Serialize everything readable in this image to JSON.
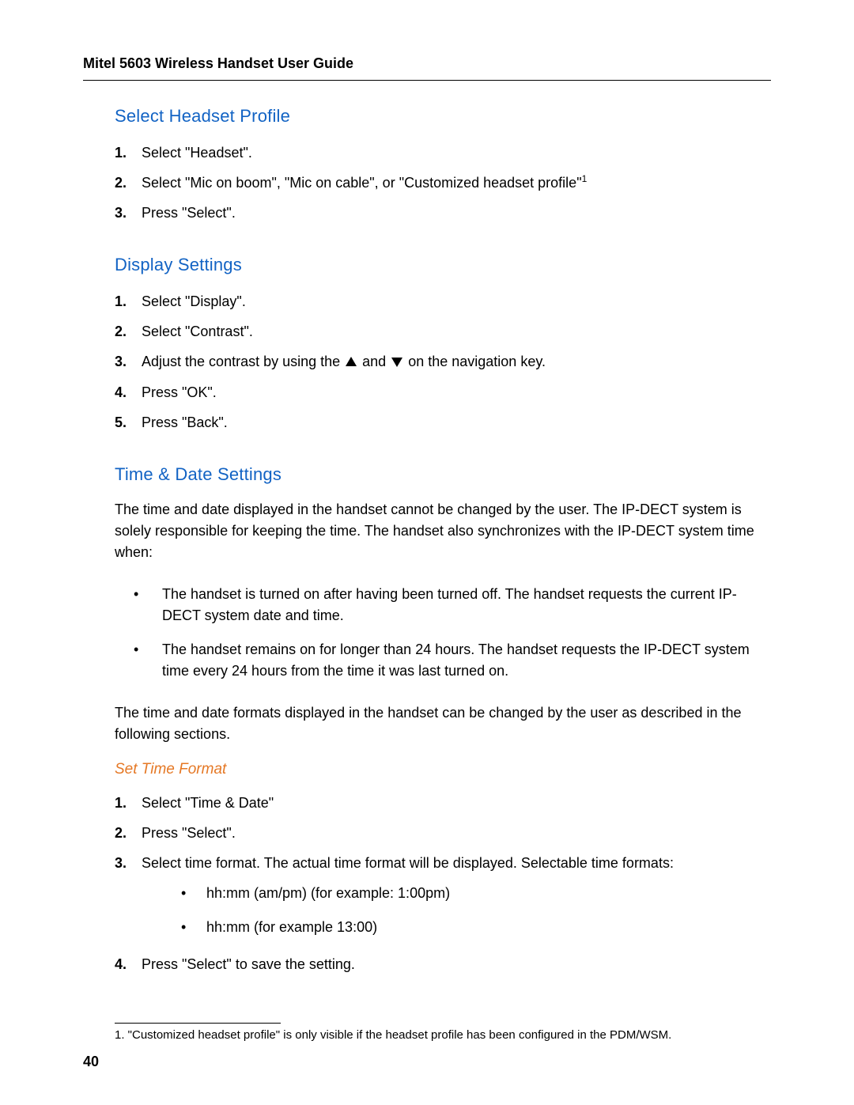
{
  "header": "Mitel 5603 Wireless Handset User Guide",
  "pageNumber": "40",
  "sectionA": {
    "title": "Select Headset Profile",
    "steps": [
      "Select \"Headset\".",
      "Select \"Mic on boom\",  \"Mic on cable\", or  \"Customized headset profile\"",
      "Press \"Select\"."
    ],
    "supRef": "1"
  },
  "sectionB": {
    "title": "Display Settings",
    "steps": {
      "s1": "Select \"Display\".",
      "s2": "Select \"Contrast\".",
      "s3a": "Adjust the contrast by using the ",
      "s3b": " and ",
      "s3c": " on the navigation key.",
      "s4": "Press \"OK\".",
      "s5": "Press \"Back\"."
    }
  },
  "sectionC": {
    "title": "Time & Date Settings",
    "para1": "The time and date displayed in the handset cannot be changed by the user. The IP-DECT system is solely responsible for keeping the time. The handset also synchronizes with the IP-DECT system time when:",
    "bullets": [
      "The handset is turned on after having been turned off. The handset requests the current IP-DECT system date and time.",
      "The handset remains on for longer than 24 hours. The handset requests the IP-DECT system time every 24 hours from the time it was last turned on."
    ],
    "para2": "The time and date formats displayed in the handset can be changed by the user as described in the following sections.",
    "subTitle": "Set Time Format",
    "steps": {
      "s1": "Select \"Time & Date\"",
      "s2": "Press \"Select\".",
      "s3": "Select time format. The actual time format will be displayed. Selectable time formats:",
      "s4": "Press \"Select\" to save the setting."
    },
    "formats": [
      "hh:mm (am/pm) (for example: 1:00pm)",
      "hh:mm  (for example 13:00)"
    ]
  },
  "footnote": "1. \"Customized headset profile\" is only visible if the headset profile has been configured in the PDM/WSM."
}
